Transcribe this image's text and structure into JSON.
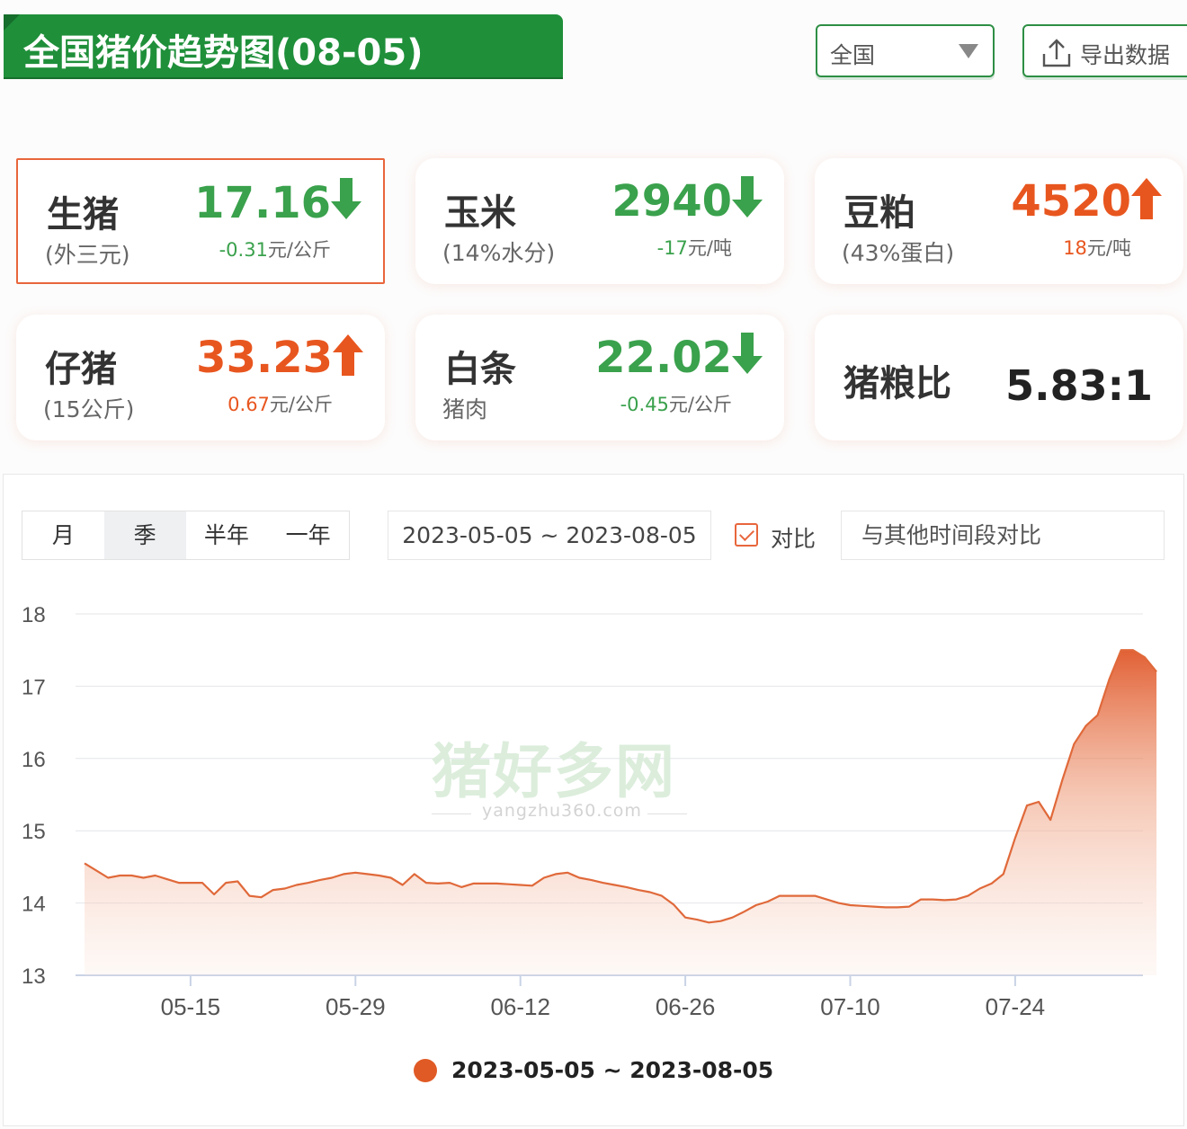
{
  "header": {
    "title": "全国猪价趋势图(08-05)",
    "region": "全国",
    "export_label": "导出数据"
  },
  "cards": [
    {
      "name": "生猪",
      "sub": "(外三元)",
      "value": "17.16",
      "direction": "down",
      "change": "-0.31",
      "unit": "元/公斤"
    },
    {
      "name": "玉米",
      "sub": "(14%水分)",
      "value": "2940",
      "direction": "down",
      "change": "-17",
      "unit": "元/吨"
    },
    {
      "name": "豆粕",
      "sub": "(43%蛋白)",
      "value": "4520",
      "direction": "up",
      "change": "18",
      "unit": "元/吨"
    },
    {
      "name": "仔猪",
      "sub": "(15公斤)",
      "value": "33.23",
      "direction": "up",
      "change": "0.67",
      "unit": "元/公斤"
    },
    {
      "name": "白条",
      "sub": "猪肉",
      "value": "22.02",
      "direction": "down",
      "change": "-0.45",
      "unit": "元/公斤"
    }
  ],
  "ratio": {
    "name": "猪粮比",
    "value": "5.83:1"
  },
  "controls": {
    "tabs": [
      "月",
      "季",
      "半年",
      "一年"
    ],
    "active_tab": "季",
    "date_range": "2023-05-05 ~ 2023-08-05",
    "compare_label": "对比",
    "compare_placeholder": "与其他时间段对比"
  },
  "watermark": {
    "cn": "猪好多网",
    "en": "yangzhu360.com"
  },
  "colors": {
    "green": "#3aa14c",
    "orange": "#e8561f",
    "line": "#e0693a"
  },
  "chart_data": {
    "type": "area",
    "title": "",
    "xlabel": "",
    "ylabel": "",
    "ylim": [
      13,
      18
    ],
    "yticks": [
      13,
      14,
      15,
      16,
      17,
      18
    ],
    "xtick_labels": [
      "05-15",
      "05-29",
      "06-12",
      "06-26",
      "07-10",
      "07-24"
    ],
    "legend": "2023-05-05 ~ 2023-08-05",
    "grid": true,
    "series": [
      {
        "name": "2023-05-05 ~ 2023-08-05",
        "x": [
          "05-06",
          "05-07",
          "05-08",
          "05-09",
          "05-10",
          "05-11",
          "05-12",
          "05-13",
          "05-14",
          "05-15",
          "05-16",
          "05-17",
          "05-18",
          "05-19",
          "05-20",
          "05-21",
          "05-22",
          "05-23",
          "05-24",
          "05-25",
          "05-26",
          "05-27",
          "05-28",
          "05-29",
          "05-30",
          "05-31",
          "06-01",
          "06-02",
          "06-03",
          "06-04",
          "06-05",
          "06-06",
          "06-07",
          "06-08",
          "06-09",
          "06-10",
          "06-11",
          "06-12",
          "06-13",
          "06-14",
          "06-15",
          "06-16",
          "06-17",
          "06-18",
          "06-19",
          "06-20",
          "06-21",
          "06-22",
          "06-23",
          "06-24",
          "06-25",
          "06-26",
          "06-27",
          "06-28",
          "06-29",
          "06-30",
          "07-01",
          "07-02",
          "07-03",
          "07-04",
          "07-05",
          "07-06",
          "07-07",
          "07-08",
          "07-09",
          "07-10",
          "07-11",
          "07-12",
          "07-13",
          "07-14",
          "07-15",
          "07-16",
          "07-17",
          "07-18",
          "07-19",
          "07-20",
          "07-21",
          "07-22",
          "07-23",
          "07-24",
          "07-25",
          "07-26",
          "07-27",
          "07-28",
          "07-29",
          "07-30",
          "07-31",
          "08-01",
          "08-02",
          "08-03",
          "08-04",
          "08-05"
        ],
        "values": [
          14.55,
          14.45,
          14.35,
          14.38,
          14.38,
          14.35,
          14.38,
          14.33,
          14.28,
          14.28,
          14.28,
          14.12,
          14.28,
          14.3,
          14.1,
          14.08,
          14.18,
          14.2,
          14.25,
          14.28,
          14.32,
          14.35,
          14.4,
          14.42,
          14.4,
          14.38,
          14.35,
          14.25,
          14.4,
          14.28,
          14.27,
          14.28,
          14.22,
          14.27,
          14.27,
          14.27,
          14.26,
          14.25,
          14.24,
          14.35,
          14.4,
          14.42,
          14.35,
          14.32,
          14.28,
          14.25,
          14.22,
          14.18,
          14.15,
          14.1,
          13.98,
          13.8,
          13.77,
          13.73,
          13.75,
          13.8,
          13.88,
          13.97,
          14.02,
          14.1,
          14.1,
          14.1,
          14.1,
          14.05,
          14.0,
          13.97,
          13.96,
          13.95,
          13.94,
          13.94,
          13.95,
          14.05,
          14.05,
          14.04,
          14.05,
          14.1,
          14.2,
          14.27,
          14.4,
          14.9,
          15.35,
          15.4,
          15.15,
          15.7,
          16.2,
          16.45,
          16.6,
          17.1,
          17.5,
          17.5,
          17.4,
          17.2
        ]
      }
    ]
  }
}
